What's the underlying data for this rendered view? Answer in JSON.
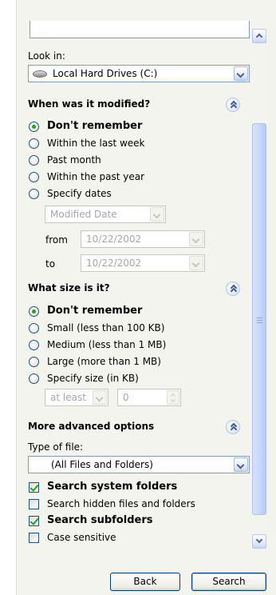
{
  "look_in": {
    "label": "Look in:",
    "value": "Local Hard Drives (C:)",
    "icon": "hard-drive-icon"
  },
  "modified": {
    "header": "When was it modified?",
    "options": [
      "Don't remember",
      "Within the last week",
      "Past month",
      "Within the past year",
      "Specify dates"
    ],
    "selected": 0,
    "date_type": "Modified Date",
    "from_label": "from",
    "from_value": "10/22/2002",
    "to_label": "to",
    "to_value": "10/22/2002"
  },
  "size": {
    "header": "What size is it?",
    "options": [
      "Don't remember",
      "Small (less than 100 KB)",
      "Medium (less than 1 MB)",
      "Large (more than 1 MB)",
      "Specify size (in KB)"
    ],
    "selected": 0,
    "qualifier": "at least",
    "amount": "0"
  },
  "advanced": {
    "header": "More advanced options",
    "type_label": "Type of file:",
    "type_value": "(All Files and Folders)",
    "checkboxes": [
      {
        "label": "Search system folders",
        "checked": true
      },
      {
        "label": "Search hidden files and folders",
        "checked": false
      },
      {
        "label": "Search subfolders",
        "checked": true
      },
      {
        "label": "Case sensitive",
        "checked": false
      }
    ]
  },
  "buttons": {
    "back": "Back",
    "search": "Search"
  },
  "colors": {
    "pane_background": "#f4f4ef",
    "field_border": "#7f9db9",
    "radio_dot": "#21a121",
    "section_header_icon": "#3a5a9f"
  }
}
